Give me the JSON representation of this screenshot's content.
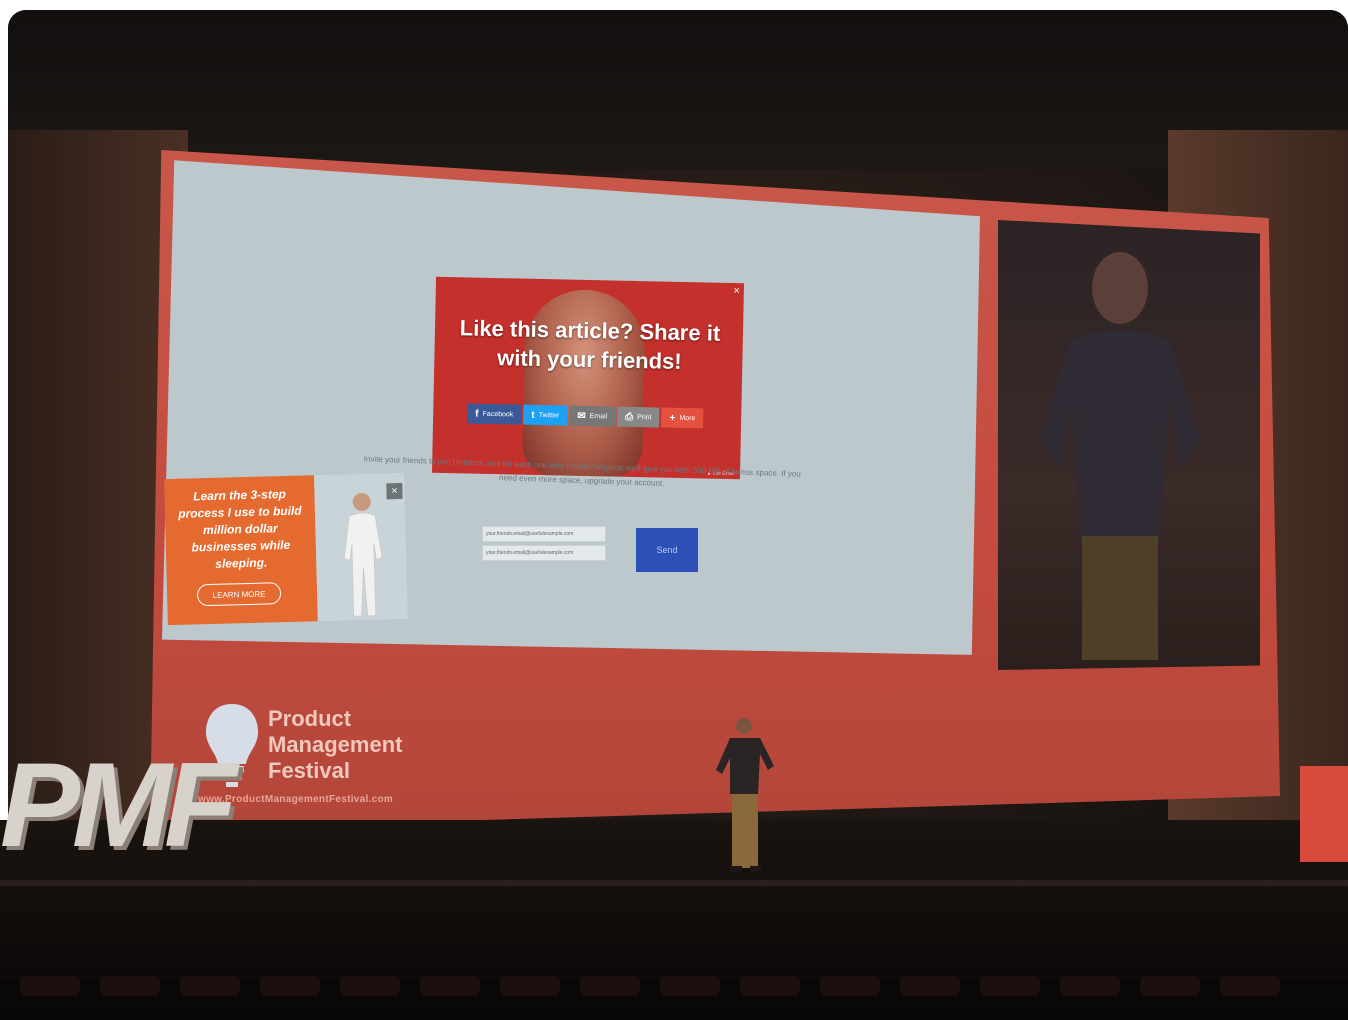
{
  "slide": {
    "popup": {
      "title": "Like this article? Share it with your friends!",
      "close": "×",
      "powered": "▲ List Grow",
      "share_buttons": [
        {
          "icon": "f",
          "label": "Facebook",
          "color": "#3b5998"
        },
        {
          "icon": "t",
          "label": "Twitter",
          "color": "#1da1f2"
        },
        {
          "icon": "✉",
          "label": "Email",
          "color": "#777777"
        },
        {
          "icon": "⎙",
          "label": "Print",
          "color": "#888888"
        },
        {
          "icon": "+",
          "label": "More",
          "color": "#e4513f"
        }
      ]
    },
    "invite_text": "Invite your friends to join Dropbox, and for each one who installs Dropbox we'll give you both 500 MB of bonus space. If you need even more space, upgrade your account.",
    "email_fields": [
      "your.friends.email@usefulexample.com",
      "your.friends.email@usefulexample.com"
    ],
    "send_label": "Send",
    "ad": {
      "text": "Learn the 3-step process I use to build million dollar businesses while sleeping.",
      "button_label": "LEARN MORE",
      "close": "×"
    }
  },
  "branding": {
    "logo_title_lines": [
      "Product",
      "Management",
      "Festival"
    ],
    "logo_url": "www.ProductManagementFestival.com",
    "stage_letters": "PMF",
    "accent_color": "#c44b3e"
  }
}
